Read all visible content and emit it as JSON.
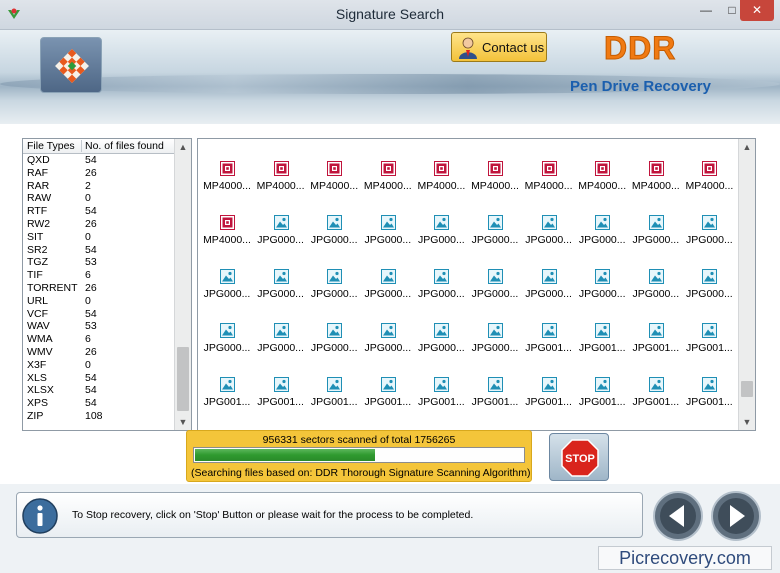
{
  "window": {
    "title": "Signature Search"
  },
  "banner": {
    "contact_label": "Contact us",
    "brand": "DDR",
    "product": "Pen Drive Recovery"
  },
  "file_types": {
    "columns": [
      "File Types",
      "No. of files found"
    ],
    "rows": [
      {
        "type": "QXD",
        "count": "54"
      },
      {
        "type": "RAF",
        "count": "26"
      },
      {
        "type": "RAR",
        "count": "2"
      },
      {
        "type": "RAW",
        "count": "0"
      },
      {
        "type": "RTF",
        "count": "54"
      },
      {
        "type": "RW2",
        "count": "26"
      },
      {
        "type": "SIT",
        "count": "0"
      },
      {
        "type": "SR2",
        "count": "54"
      },
      {
        "type": "TGZ",
        "count": "53"
      },
      {
        "type": "TIF",
        "count": "6"
      },
      {
        "type": "TORRENT",
        "count": "26"
      },
      {
        "type": "URL",
        "count": "0"
      },
      {
        "type": "VCF",
        "count": "54"
      },
      {
        "type": "WAV",
        "count": "53"
      },
      {
        "type": "WMA",
        "count": "6"
      },
      {
        "type": "WMV",
        "count": "26"
      },
      {
        "type": "X3F",
        "count": "0"
      },
      {
        "type": "XLS",
        "count": "54"
      },
      {
        "type": "XLSX",
        "count": "54"
      },
      {
        "type": "XPS",
        "count": "54"
      },
      {
        "type": "ZIP",
        "count": "108"
      }
    ]
  },
  "found_files": [
    {
      "name": "MP4000...",
      "icon": "video-file-icon"
    },
    {
      "name": "MP4000...",
      "icon": "video-file-icon"
    },
    {
      "name": "MP4000...",
      "icon": "video-file-icon"
    },
    {
      "name": "MP4000...",
      "icon": "video-file-icon"
    },
    {
      "name": "MP4000...",
      "icon": "video-file-icon"
    },
    {
      "name": "MP4000...",
      "icon": "video-file-icon"
    },
    {
      "name": "MP4000...",
      "icon": "video-file-icon"
    },
    {
      "name": "MP4000...",
      "icon": "video-file-icon"
    },
    {
      "name": "MP4000...",
      "icon": "video-file-icon"
    },
    {
      "name": "MP4000...",
      "icon": "video-file-icon"
    },
    {
      "name": "MP4000...",
      "icon": "video-file-icon"
    },
    {
      "name": "JPG000...",
      "icon": "image-file-icon"
    },
    {
      "name": "JPG000...",
      "icon": "image-file-icon"
    },
    {
      "name": "JPG000...",
      "icon": "image-file-icon"
    },
    {
      "name": "JPG000...",
      "icon": "image-file-icon"
    },
    {
      "name": "JPG000...",
      "icon": "image-file-icon"
    },
    {
      "name": "JPG000...",
      "icon": "image-file-icon"
    },
    {
      "name": "JPG000...",
      "icon": "image-file-icon"
    },
    {
      "name": "JPG000...",
      "icon": "image-file-icon"
    },
    {
      "name": "JPG000...",
      "icon": "image-file-icon"
    },
    {
      "name": "JPG000...",
      "icon": "image-file-icon"
    },
    {
      "name": "JPG000...",
      "icon": "image-file-icon"
    },
    {
      "name": "JPG000...",
      "icon": "image-file-icon"
    },
    {
      "name": "JPG000...",
      "icon": "image-file-icon"
    },
    {
      "name": "JPG000...",
      "icon": "image-file-icon"
    },
    {
      "name": "JPG000...",
      "icon": "image-file-icon"
    },
    {
      "name": "JPG000...",
      "icon": "image-file-icon"
    },
    {
      "name": "JPG000...",
      "icon": "image-file-icon"
    },
    {
      "name": "JPG000...",
      "icon": "image-file-icon"
    },
    {
      "name": "JPG000...",
      "icon": "image-file-icon"
    },
    {
      "name": "JPG000...",
      "icon": "image-file-icon"
    },
    {
      "name": "JPG000...",
      "icon": "image-file-icon"
    },
    {
      "name": "JPG000...",
      "icon": "image-file-icon"
    },
    {
      "name": "JPG000...",
      "icon": "image-file-icon"
    },
    {
      "name": "JPG000...",
      "icon": "image-file-icon"
    },
    {
      "name": "JPG000...",
      "icon": "image-file-icon"
    },
    {
      "name": "JPG001...",
      "icon": "image-file-icon"
    },
    {
      "name": "JPG001...",
      "icon": "image-file-icon"
    },
    {
      "name": "JPG001...",
      "icon": "image-file-icon"
    },
    {
      "name": "JPG001...",
      "icon": "image-file-icon"
    },
    {
      "name": "JPG001...",
      "icon": "image-file-icon"
    },
    {
      "name": "JPG001...",
      "icon": "image-file-icon"
    },
    {
      "name": "JPG001...",
      "icon": "image-file-icon"
    },
    {
      "name": "JPG001...",
      "icon": "image-file-icon"
    },
    {
      "name": "JPG001...",
      "icon": "image-file-icon"
    },
    {
      "name": "JPG001...",
      "icon": "image-file-icon"
    },
    {
      "name": "JPG001...",
      "icon": "image-file-icon"
    },
    {
      "name": "JPG001...",
      "icon": "image-file-icon"
    },
    {
      "name": "JPG001...",
      "icon": "image-file-icon"
    },
    {
      "name": "JPG001...",
      "icon": "image-file-icon"
    }
  ],
  "progress": {
    "status": "956331 sectors scanned of total 1756265",
    "scanned": 956331,
    "total": 1756265,
    "note": "(Searching files based on:  DDR Thorough Signature Scanning Algorithm)"
  },
  "footer": {
    "message": "To Stop recovery, click on 'Stop' Button or please wait for the process to be completed.",
    "watermark": "Picrecovery.com"
  },
  "colors": {
    "progress_panel": "#f4c53a",
    "progress_fill": "#2f9a2f",
    "brand": "#f07a12",
    "product": "#1b5fae",
    "video_icon": "#c0143c",
    "image_icon": "#1f8fb5"
  }
}
